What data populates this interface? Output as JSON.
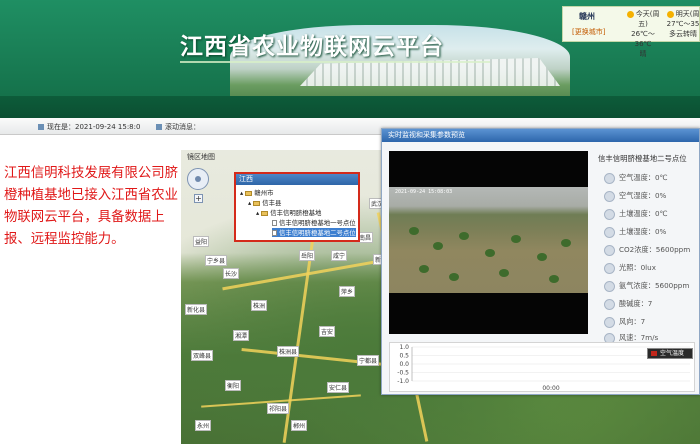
{
  "header": {
    "title": "江西省农业物联网云平台"
  },
  "weather": {
    "city": "赣州",
    "change_city": "[更换城市]",
    "days": [
      {
        "label": "今天(周五)",
        "temp": "26℃～36℃",
        "cond": "晴"
      },
      {
        "label": "明天(周",
        "temp": "27℃～35",
        "cond": "多云转晴"
      }
    ]
  },
  "status": {
    "now": "现在是：2021-09-24 15:8:0",
    "roll": "滚动消息："
  },
  "caption": "江西信明科技发展有限公司脐橙种植基地已接入江西省农业物联网云平台，具备数据上报、远程监控能力。",
  "map": {
    "nav_text": "镜区地图",
    "zoom_plus": "+",
    "labels": [
      "长沙",
      "株洲",
      "武汉",
      "宜春",
      "新余",
      "萍乡",
      "咸宁",
      "岳阳",
      "益阳",
      "吉安",
      "湘潭",
      "衡阳",
      "永州",
      "郴州",
      "抚州",
      "南昌",
      "宁都县",
      "宁乡县",
      "双峰县",
      "祁阳县",
      "新化县",
      "株洲县",
      "安仁县"
    ]
  },
  "tree": {
    "header": "江西",
    "nodes": [
      {
        "text": "赣州市",
        "type": "folder",
        "level": 1
      },
      {
        "text": "信丰县",
        "type": "folder",
        "level": 2
      },
      {
        "text": "信丰信明脐橙基地",
        "type": "folder",
        "level": 3
      },
      {
        "text": "信丰信明脐橙基地一号点位",
        "type": "leaf",
        "level": 4
      },
      {
        "text": "信丰信明脐橙基地二号点位",
        "type": "leaf",
        "level": 4,
        "selected": true
      }
    ]
  },
  "video_window": {
    "title": "实时监视和采集参数预览",
    "timestamp": "2021-09-24 15:08:03",
    "site": "信丰信明脐橙基地二号点位",
    "sensors": [
      {
        "label": "空气温度：0℃",
        "icon": "thermometer-icon"
      },
      {
        "label": "空气湿度：0%",
        "icon": "humidity-icon"
      },
      {
        "label": "土壤温度：0℃",
        "icon": "soil-temperature-icon"
      },
      {
        "label": "土壤湿度：0%",
        "icon": "soil-humidity-icon"
      },
      {
        "label": "CO2浓度：5600ppm",
        "icon": "co2-icon"
      },
      {
        "label": "光照：0lux",
        "icon": "sun-icon"
      },
      {
        "label": "氨气浓度：5600ppm",
        "icon": "ammonia-icon"
      },
      {
        "label": "酸碱度：7",
        "icon": "ph-icon"
      },
      {
        "label": "风向：7",
        "icon": "wind-direction-icon"
      },
      {
        "label": "风速：7m/s",
        "icon": "wind-speed-icon"
      }
    ],
    "legend": "空气温度"
  },
  "chart_data": {
    "type": "line",
    "x": [
      "00:00"
    ],
    "series": [
      {
        "name": "空气温度",
        "values": []
      }
    ],
    "yticks": [
      "1.0",
      "0.5",
      "0.0",
      "-0.5",
      "-1.0"
    ],
    "ylim": [
      -1.0,
      1.0
    ],
    "xlabel": "",
    "ylabel": "",
    "legend_position": "top-right"
  },
  "colors": {
    "header_green": "#1a7f56",
    "caption_red": "#e01818",
    "tree_border": "#d42a1a",
    "window_blue": "#2d66ab",
    "legend_series": "#c2271b"
  }
}
